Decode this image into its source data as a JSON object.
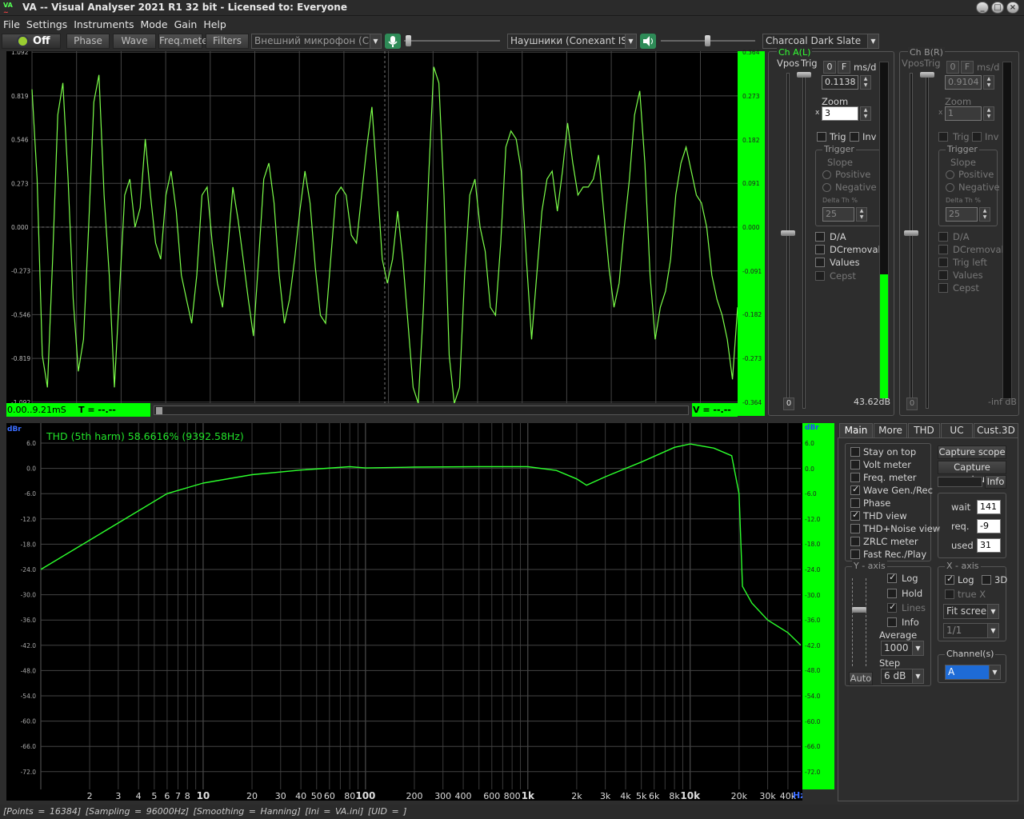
{
  "window": {
    "icon_text_top": "VA",
    "icon_text_bottom": "~",
    "title": "VA -- Visual Analyser 2021 R1 32 bit - Licensed to: Everyone",
    "controls": [
      "_",
      "□",
      "×"
    ]
  },
  "menu": [
    "File",
    "Settings",
    "Instruments",
    "Mode",
    "Gain",
    "Help"
  ],
  "toolbar": {
    "power_label": "Off",
    "phase": "Phase",
    "wave": "Wave",
    "freqmeter": "Freq.meter",
    "filters": "Filters",
    "input_device": "Внешний микрофон (Conexa",
    "output_device": "Наушники (Conexant ISST Au",
    "theme": "Charcoal Dark Slate",
    "mic_icon": "microphone-icon",
    "speaker_icon": "speaker-icon"
  },
  "scope": {
    "y_labels_left": [
      "1.092",
      "0.819",
      "0.546",
      "0.273",
      "0.000",
      "-0.273",
      "-0.546",
      "-0.819",
      "-1.092"
    ],
    "y_labels_right": [
      "0.364",
      "0.273",
      "0.182",
      "0.091",
      "0.000",
      "-0.091",
      "-0.182",
      "-0.273",
      "-0.364"
    ],
    "trace_color": "#7CFF4A",
    "trace": [
      0.86,
      0.3,
      -0.8,
      -1.0,
      -0.2,
      0.7,
      0.9,
      0.3,
      -0.45,
      -0.9,
      -0.7,
      0.0,
      0.78,
      0.95,
      0.2,
      -0.3,
      -1.0,
      -0.4,
      0.2,
      0.3,
      0.0,
      0.12,
      0.55,
      0.2,
      -0.1,
      -0.2,
      0.2,
      0.35,
      0.1,
      -0.3,
      -0.45,
      -0.6,
      -0.3,
      0.2,
      0.25,
      -0.1,
      -0.35,
      -0.5,
      -0.15,
      0.25,
      0.05,
      -0.2,
      -0.45,
      -0.68,
      -0.2,
      0.3,
      0.4,
      0.15,
      -0.3,
      -0.6,
      -0.45,
      -0.2,
      0.1,
      0.35,
      0.15,
      -0.25,
      -0.55,
      -0.6,
      -0.2,
      0.2,
      0.25,
      0.2,
      -0.05,
      -0.1,
      0.2,
      0.5,
      0.75,
      0.3,
      -0.2,
      -0.35,
      -0.2,
      0.1,
      -0.2,
      -0.6,
      -1.0,
      -1.1,
      -0.5,
      0.3,
      1.0,
      0.9,
      0.2,
      -0.8,
      -1.1,
      -1.0,
      -0.3,
      0.2,
      0.3,
      0.0,
      -0.15,
      -0.5,
      -0.55,
      -0.1,
      0.5,
      0.6,
      0.55,
      0.35,
      -0.2,
      -0.7,
      -0.3,
      0.1,
      0.3,
      0.35,
      0.1,
      0.35,
      0.65,
      0.4,
      0.2,
      0.25,
      0.25,
      0.3,
      0.45,
      0.1,
      -0.25,
      -0.5,
      -0.35,
      0.0,
      0.3,
      0.7,
      0.85,
      0.4,
      -0.3,
      -0.7,
      -0.5,
      -0.4,
      -0.2,
      0.2,
      0.4,
      0.5,
      0.35,
      0.2,
      0.15,
      0.0,
      -0.3,
      -0.45,
      -0.55,
      -0.7,
      -0.95,
      -0.5
    ],
    "status_left": "0.00..9.21mS",
    "status_t": "T = --.--",
    "status_v": "V = --.--"
  },
  "chA": {
    "title": "Ch A(L)",
    "vpos": "Vpos",
    "trig": "Trig",
    "zero_btn": "0",
    "f_btn": "F",
    "unit": "ms/d",
    "msd_value": "0.1138",
    "zoom_label": "Zoom",
    "zoom_x": "x",
    "zoom_value": "3",
    "trig_check": "Trig",
    "inv_check": "Inv",
    "trigger_group": "Trigger",
    "slope": "Slope",
    "positive": "Positive",
    "negative": "Negative",
    "delta": "Delta Th %",
    "delta_value": "25",
    "da": "D/A",
    "dcremoval": "DCremoval",
    "values": "Values",
    "cepst": "Cepst",
    "bottom_zero": "0",
    "level": "43.62dB",
    "level_fraction": 0.37
  },
  "chB": {
    "title": "Ch B(R)",
    "vpos": "Vpos",
    "trig": "Trig",
    "zero_btn": "0",
    "f_btn": "F",
    "unit": "ms/d",
    "msd_value": "0.9104",
    "zoom_label": "Zoom",
    "zoom_x": "x",
    "zoom_value": "1",
    "trig_check": "Trig",
    "inv_check": "Inv",
    "trigger_group": "Trigger",
    "slope": "Slope",
    "positive": "Positive",
    "negative": "Negative",
    "delta": "Delta Th %",
    "delta_value": "25",
    "da": "D/A",
    "dcremoval": "DCremoval",
    "trigleft": "Trig left",
    "values": "Values",
    "cepst": "Cepst",
    "bottom_zero": "0",
    "level": "-inf dB",
    "level_fraction": 0
  },
  "spectrum": {
    "unit_left": "dBr",
    "unit_right": "dBr",
    "thd_label": "THD (5th harm) 58.6616% (9392.58Hz)",
    "hz_unit": "Hz",
    "y_labels": [
      "6.0",
      "0.0",
      "-6.0",
      "-12.0",
      "-18.0",
      "-24.0",
      "-30.0",
      "-36.0",
      "-42.0",
      "-48.0",
      "-54.0",
      "-60.0",
      "-66.0",
      "-72.0"
    ],
    "x_labels": [
      {
        "f": 2,
        "t": "2"
      },
      {
        "f": 3,
        "t": "3"
      },
      {
        "f": 4,
        "t": "4"
      },
      {
        "f": 5,
        "t": "5"
      },
      {
        "f": 6,
        "t": "6"
      },
      {
        "f": 7,
        "t": "7"
      },
      {
        "f": 8,
        "t": "8"
      },
      {
        "f": 10,
        "t": "10"
      },
      {
        "f": 20,
        "t": "20"
      },
      {
        "f": 30,
        "t": "30"
      },
      {
        "f": 40,
        "t": "40"
      },
      {
        "f": 50,
        "t": "50"
      },
      {
        "f": 60,
        "t": "60"
      },
      {
        "f": 80,
        "t": "80"
      },
      {
        "f": 100,
        "t": "100"
      },
      {
        "f": 200,
        "t": "200"
      },
      {
        "f": 300,
        "t": "300"
      },
      {
        "f": 400,
        "t": "400"
      },
      {
        "f": 600,
        "t": "600"
      },
      {
        "f": 800,
        "t": "800"
      },
      {
        "f": 1000,
        "t": "1k"
      },
      {
        "f": 2000,
        "t": "2k"
      },
      {
        "f": 3000,
        "t": "3k"
      },
      {
        "f": 4000,
        "t": "4k"
      },
      {
        "f": 5000,
        "t": "5k"
      },
      {
        "f": 6000,
        "t": "6k"
      },
      {
        "f": 8000,
        "t": "8k"
      },
      {
        "f": 10000,
        "t": "10k"
      },
      {
        "f": 20000,
        "t": "20k"
      },
      {
        "f": 30000,
        "t": "30k"
      },
      {
        "f": 40000,
        "t": "40k"
      }
    ],
    "curve": [
      [
        1,
        -24
      ],
      [
        6,
        -6
      ],
      [
        10,
        -3.5
      ],
      [
        20,
        -1.5
      ],
      [
        40,
        -0.4
      ],
      [
        80,
        0.4
      ],
      [
        100,
        0.1
      ],
      [
        200,
        0.3
      ],
      [
        500,
        0.4
      ],
      [
        1000,
        0.4
      ],
      [
        1500,
        -0.5
      ],
      [
        2000,
        -2.5
      ],
      [
        2300,
        -4
      ],
      [
        3000,
        -2
      ],
      [
        5000,
        1.5
      ],
      [
        8000,
        5
      ],
      [
        10000,
        5.8
      ],
      [
        14000,
        4.8
      ],
      [
        18000,
        3
      ],
      [
        20000,
        -6
      ],
      [
        21000,
        -28
      ],
      [
        24000,
        -32
      ],
      [
        30000,
        -36
      ],
      [
        40000,
        -39
      ],
      [
        48000,
        -42
      ]
    ]
  },
  "tabs": [
    "Main",
    "More",
    "THD",
    "UC",
    "Cust.3D"
  ],
  "main_tab": {
    "checks": [
      {
        "label": "Stay on top",
        "on": false
      },
      {
        "label": "Volt meter",
        "on": false
      },
      {
        "label": "Freq. meter",
        "on": false
      },
      {
        "label": "Wave Gen./Rec",
        "on": true
      },
      {
        "label": "Phase",
        "on": false
      },
      {
        "label": "THD view",
        "on": true
      },
      {
        "label": "THD+Noise view",
        "on": false
      },
      {
        "label": "ZRLC meter",
        "on": false
      },
      {
        "label": "Fast Rec./Play",
        "on": false
      }
    ],
    "capture_scope": "Capture scope",
    "capture_spectrum": "Capture spectrum",
    "info": "Info",
    "wait_label": "wait",
    "wait_value": "141",
    "req_label": "req.",
    "req_value": "-9",
    "used_label": "used",
    "used_value": "31",
    "yaxis_title": "Y - axis",
    "log": "Log",
    "hold": "Hold",
    "lines": "Lines",
    "info_check": "Info",
    "average": "Average",
    "average_value": "1000",
    "step": "Step",
    "step_value": "6 dB",
    "auto": "Auto",
    "xaxis_title": "X - axis",
    "xlog": "Log",
    "x3d": "3D",
    "truex": "true X",
    "fit": "Fit screen",
    "ratio": "1/1",
    "channels_title": "Channel(s)",
    "channel_value": "A"
  },
  "statusbar": "[Points = 16384]  [Sampling = 96000Hz]  [Smoothing = Hanning]  [Ini = VA.ini]  [UID = ]"
}
